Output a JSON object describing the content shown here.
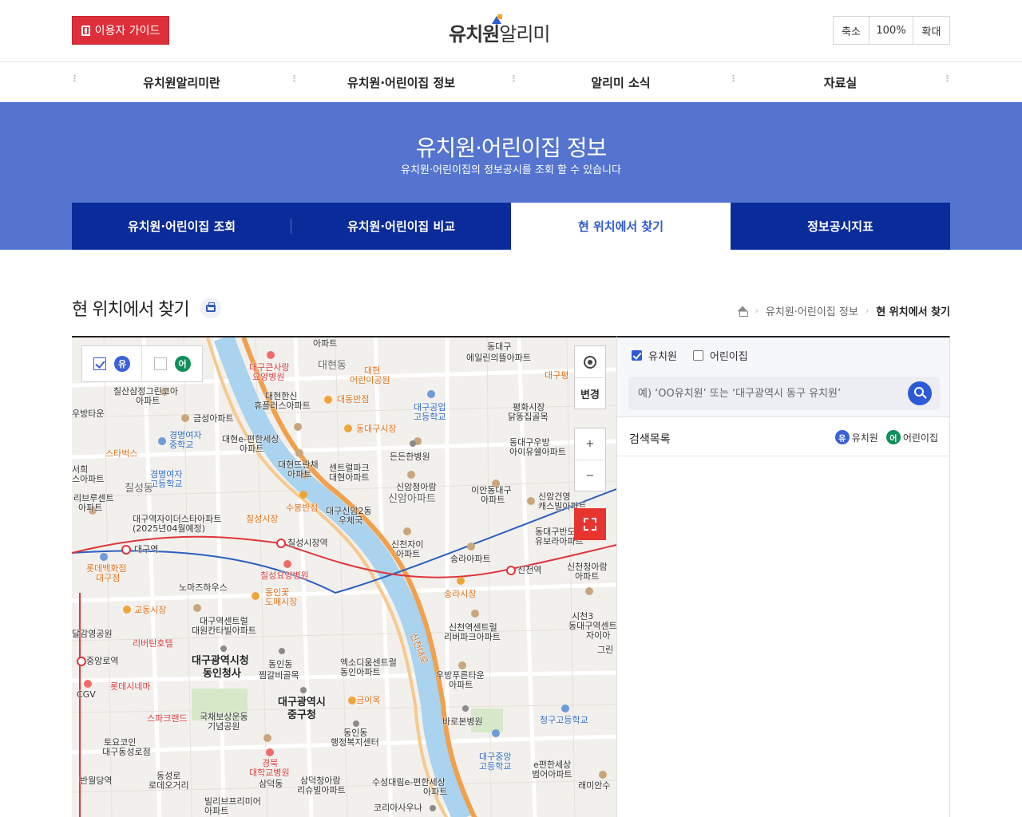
{
  "header": {
    "guide_button": "이용자 가이드",
    "logo_bold": "유치원",
    "logo_light": "알리미",
    "zoom_out": "축소",
    "zoom_level": "100%",
    "zoom_in": "확대"
  },
  "nav": {
    "items": [
      {
        "label": "유치원알리미란"
      },
      {
        "label": "유치원·어린이집 정보"
      },
      {
        "label": "알리미 소식"
      },
      {
        "label": "자료실"
      }
    ]
  },
  "hero": {
    "title": "유치원·어린이집 정보",
    "subtitle": "유치원·어린이집의 정보공시를 조회 할 수 있습니다"
  },
  "tabs": [
    {
      "label": "유치원·어린이집 조회"
    },
    {
      "label": "유치원·어린이집 비교"
    },
    {
      "label": "현 위치에서 찾기"
    },
    {
      "label": "정보공시지표"
    }
  ],
  "page": {
    "title": "현 위치에서 찾기",
    "breadcrumb": [
      "유치원·어린이집 정보",
      "현 위치에서 찾기"
    ]
  },
  "map": {
    "filter": {
      "kindergarten_badge": "유",
      "daycare_badge": "어"
    },
    "controls": {
      "change_label": "변경",
      "plus": "+",
      "minus": "−"
    },
    "labels": {
      "l1": "아파트",
      "l2": "동대구",
      "l3": "에일린의뜰아파트",
      "l4": "대구큰사랑",
      "l5": "요양병원",
      "l6": "대현동",
      "l7": "대현",
      "l8": "어린이공원",
      "l9": "대구평",
      "l10": "칠산삼정그린코아",
      "l11": "대현한신",
      "l12": "휴플러스아파트",
      "l13": "대동반점",
      "l14": "대구공업",
      "l15": "고등학교",
      "l16": "평화시장",
      "l17": "닭똥집골목",
      "l18": "우방타운",
      "l19": "금성아파트",
      "l20": "경명여자",
      "l21": "중학교",
      "l22": "대현e-편한세상",
      "l23": "동대구시장",
      "l24": "동대구우방",
      "l25": "아이유쉘아파트",
      "l26": "스타벅스",
      "l27": "든든한병원",
      "l28": "서희",
      "l29": "스아파트",
      "l30": "경명여자",
      "l31": "고등학교",
      "l32": "칠성동",
      "l33": "대현뜨란채",
      "l34": "센트럴파크",
      "l35": "대현아파트",
      "l36": "신암청아람",
      "l37": "신암아파트",
      "l38": "이안동대구",
      "l39": "신암건영",
      "l40": "캐스빌아파트",
      "l41": "리브루센트",
      "l42": "수봉반점",
      "l43": "대구신암2동",
      "l44": "우체국",
      "l45": "대구역자이더스타아파트",
      "l46": "(2025년04월예정)",
      "l47": "칠성시장",
      "l48": "동대구반도",
      "l49": "유보라아파트",
      "l50": "대구역",
      "l51": "칠성시장역",
      "l52": "신천자이",
      "l53": "송라아파트",
      "l54": "신천역",
      "l55": "신천청아람",
      "l56": "롯데백화점",
      "l57": "대구점",
      "l58": "칠성요양병원",
      "l59": "노마즈하우스",
      "l60": "동인꽃",
      "l61": "도매시장",
      "l62": "송라시장",
      "l63": "교동시장",
      "l64": "대구역센트럴",
      "l65": "대원칸타빌아파트",
      "l66": "신천역센트럴",
      "l67": "리버파크아파트",
      "l68": "시천3",
      "l69": "동대구역센트",
      "l70": "자이아",
      "l71": "달감영공원",
      "l72": "리버틴호텔",
      "l73": "그린",
      "l74": "중앙로역",
      "l75": "대구광역시청",
      "l76": "동인청사",
      "l77": "동인동",
      "l78": "찜갈비골목",
      "l79": "엑소디움센트럴",
      "l80": "동인아파트",
      "l81": "우방푸른타운",
      "l82": "롯데시네마",
      "l83": "CGV",
      "l84": "대구광역시",
      "l85": "중구청",
      "l86": "금이옥",
      "l87": "스파크랜드",
      "l88": "국채보상운동",
      "l89": "기념공원",
      "l90": "바로본병원",
      "l91": "청구고등학교",
      "l92": "토요코인",
      "l93": "대구동성로점",
      "l94": "동인동",
      "l95": "행정복지센터",
      "l96": "경북",
      "l97": "대학교병원",
      "l98": "대구중앙",
      "l99": "고등학교",
      "l100": "e편한세상",
      "l101": "범어아파트",
      "l102": "반월당역",
      "l103": "동성로",
      "l104": "로데오거리",
      "l105": "삼덕동",
      "l106": "삼덕청아람",
      "l107": "리슈빌아파트",
      "l108": "수성대림e-편한세상",
      "l109": "아파트",
      "l110": "래미안수",
      "l111": "빌리브프리미어",
      "l112": "아파트",
      "l113": "코리아사우나",
      "l114": "신천대로"
    }
  },
  "side": {
    "check_kindergarten": "유치원",
    "check_daycare": "어린이집",
    "search_placeholder": "예) ‘OO유치원’ 또는 ‘대구광역시 동구 유치원’",
    "list_title": "검색목록",
    "legend_kindergarten": "유치원",
    "legend_daycare": "어린이집",
    "badge_yu": "유",
    "badge_eo": "어"
  }
}
